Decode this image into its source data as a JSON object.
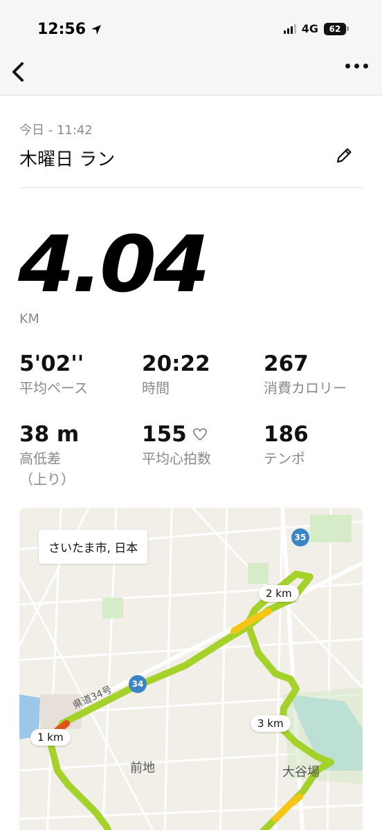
{
  "status_bar": {
    "time": "12:56",
    "network": "4G",
    "battery": "62"
  },
  "nav": {
    "back_icon": "chevron-left-icon",
    "more_icon": "ellipsis-icon"
  },
  "activity": {
    "date": "今日 - 11:42",
    "title": "木曜日 ラン",
    "distance": "4.04",
    "unit": "KM"
  },
  "stats": [
    {
      "value": "5'02''",
      "label": "平均ペース"
    },
    {
      "value": "20:22",
      "label": "時間"
    },
    {
      "value": "267",
      "label": "消費カロリー"
    },
    {
      "value": "38 m",
      "label": "高低差\n（上り）"
    },
    {
      "value": "155",
      "label": "平均心拍数"
    },
    {
      "value": "186",
      "label": "テンポ"
    }
  ],
  "map": {
    "location_label": "さいたま市, 日本",
    "km_markers": [
      "1 km",
      "2 km",
      "3 km"
    ],
    "places": [
      "前地",
      "大谷場"
    ],
    "road_numbers": [
      "34",
      "35"
    ],
    "road_name": "県道34号",
    "colors": {
      "route_fast": "#a4d12a",
      "route_slow": "#f5c518",
      "route_slowest": "#e0521c"
    }
  }
}
